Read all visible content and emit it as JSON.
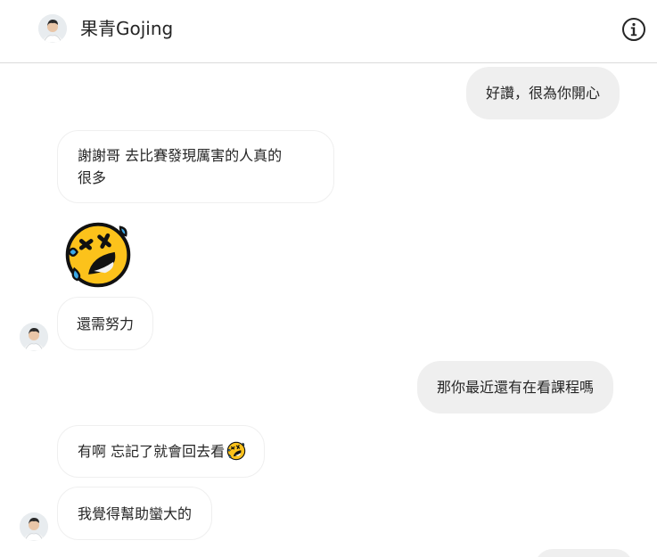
{
  "header": {
    "contact_name": "果青Gojing",
    "avatar_icon": "profile-photo",
    "info_icon": "info-circle-icon"
  },
  "messages": [
    {
      "sender": "me",
      "text": "好讚，很為你開心"
    },
    {
      "sender": "contact",
      "text_line1": "謝謝哥 去比賽發現厲害的人真的",
      "text_line2": "很多"
    },
    {
      "sender": "contact",
      "emoji": "rolling-on-floor-laughing-emoji"
    },
    {
      "sender": "contact",
      "text": "還需努力"
    },
    {
      "sender": "me",
      "text": "那你最近還有在看課程嗎"
    },
    {
      "sender": "contact",
      "text": "有啊 忘記了就會回去看",
      "emoji": "rolling-on-floor-laughing-emoji"
    },
    {
      "sender": "contact",
      "text": "我覺得幫助蠻大的"
    },
    {
      "sender": "me",
      "text": ""
    }
  ],
  "colors": {
    "sent_bubble": "#efefef",
    "received_border": "#efefef",
    "text": "#262626",
    "divider": "#dbdbdb"
  }
}
